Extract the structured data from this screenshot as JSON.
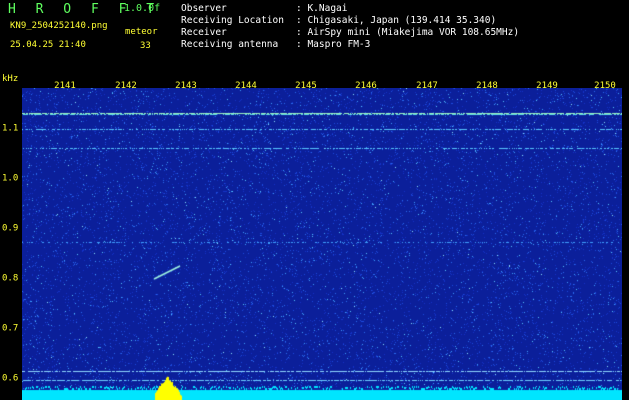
{
  "header": {
    "title": "H R O F F T",
    "version": "1.0.0f",
    "filename": "KN9_2504252140.png",
    "meteor_label": "meteor",
    "datetime": "25.04.25 21:40",
    "meteor_count": "33"
  },
  "metadata": [
    {
      "label": "Observer",
      "value": ": K.Nagai"
    },
    {
      "label": "Receiving Location",
      "value": ": Chigasaki, Japan (139.414 35.340)"
    },
    {
      "label": "Receiver",
      "value": ": AirSpy mini (Miakejima VOR 108.65MHz)"
    },
    {
      "label": "Receiving antenna",
      "value": ": Maspro FM-3"
    }
  ],
  "axis": {
    "unit": "kHz",
    "time_ticks": [
      "2141",
      "2142",
      "2143",
      "2144",
      "2145",
      "2146",
      "2147",
      "2148",
      "2149",
      "2150"
    ],
    "freq_ticks": [
      "1.1",
      "1.0",
      "0.9",
      "0.8",
      "0.7",
      "0.6"
    ]
  },
  "colors": {
    "background": "#000000",
    "spectrogram_base": "#0b1f9a",
    "noise": "#3fa0ff",
    "carrier": "#8ff0d0",
    "baseline": "#00e5ff",
    "burst": "#ffff00",
    "text_green": "#5fff5f",
    "text_yellow": "#ffff33"
  }
}
